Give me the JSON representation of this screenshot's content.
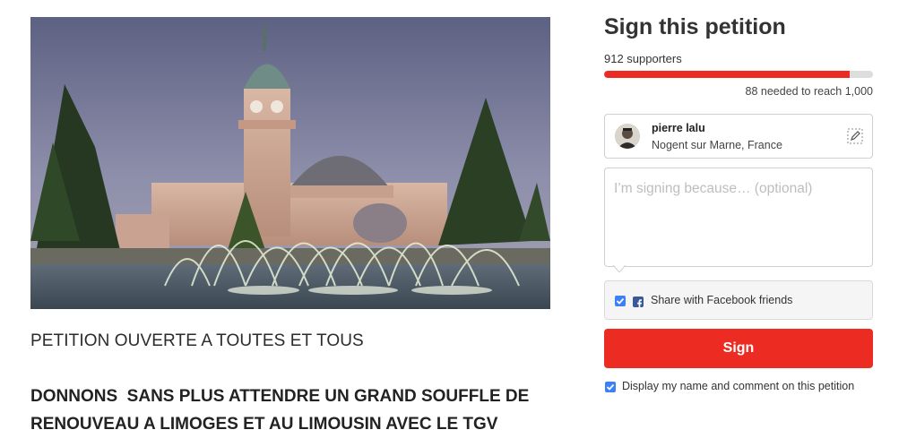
{
  "hero": {
    "alt": "Limoges-Bénédictins railway station with fountain"
  },
  "article": {
    "subtitle": "PETITION OUVERTE A TOUTES ET TOUS",
    "headline_line1": "DONNONS  SANS PLUS ATTENDRE UN GRAND SOUFFLE DE",
    "headline_line2": "RENOUVEAU A LIMOGES ET AU LIMOUSIN AVEC LE TGV"
  },
  "sign_panel": {
    "title": "Sign this petition",
    "supporters_text": "912 supporters",
    "progress_fraction": 0.912,
    "needed_text": "88 needed to reach 1,000",
    "user": {
      "name": "pierre lalu",
      "location": "Nogent sur Marne, France"
    },
    "comment_placeholder": "I’m signing because… (optional)",
    "facebook_share": {
      "label": "Share with Facebook friends",
      "checked": true
    },
    "sign_button_label": "Sign",
    "display_name_option": {
      "label": "Display my name and comment on this petition",
      "checked": true
    }
  },
  "colors": {
    "accent_red": "#ec2c22",
    "checkbox_blue": "#3b80f7",
    "facebook_blue": "#3b5998"
  },
  "icons": {
    "edit": "pencil-edit-icon",
    "facebook": "facebook-icon",
    "check": "checkmark-icon"
  }
}
